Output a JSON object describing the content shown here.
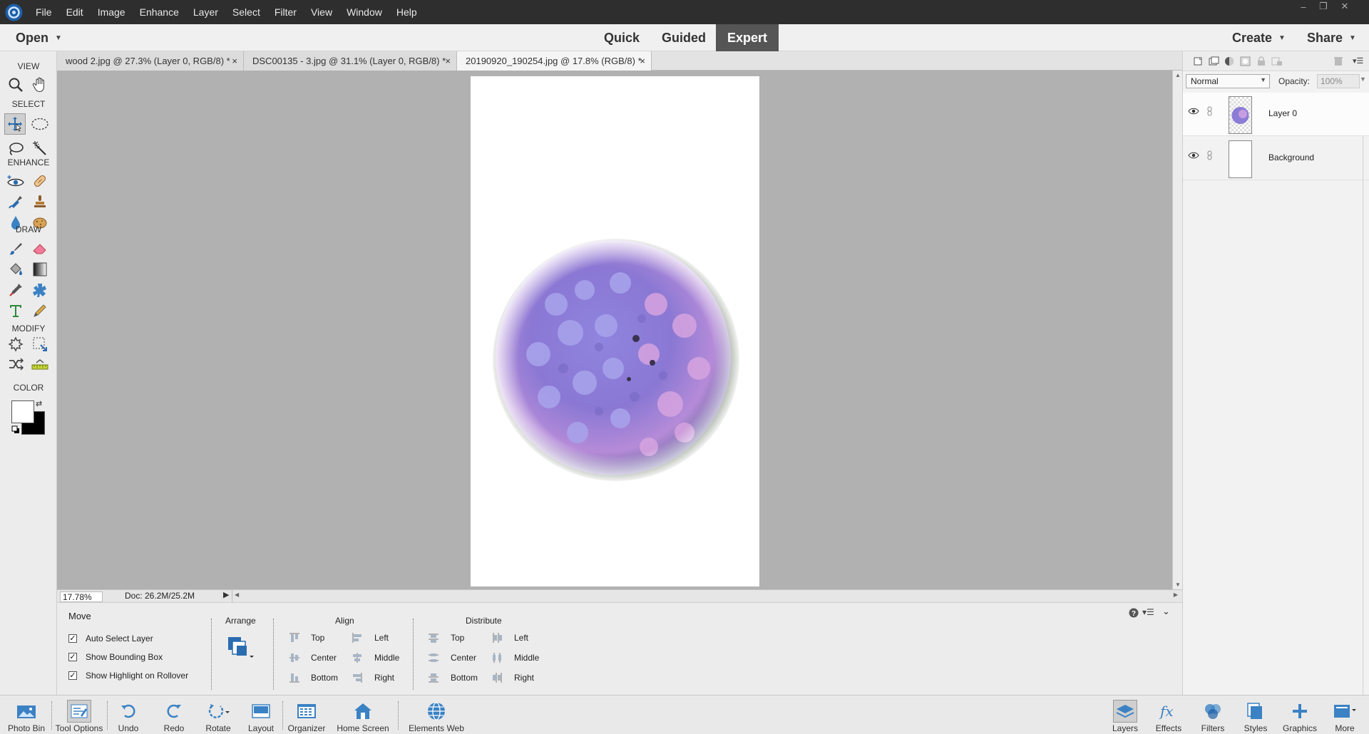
{
  "menu": [
    "File",
    "Edit",
    "Image",
    "Enhance",
    "Layer",
    "Select",
    "Filter",
    "View",
    "Window",
    "Help"
  ],
  "modebar": {
    "open": "Open",
    "modes": [
      "Quick",
      "Guided",
      "Expert"
    ],
    "active_mode": "Expert",
    "create": "Create",
    "share": "Share"
  },
  "tools": {
    "groups": [
      "VIEW",
      "SELECT",
      "ENHANCE",
      "DRAW",
      "MODIFY",
      "COLOR"
    ],
    "active_tool": "move-tool",
    "foreground_color": "#ffffff",
    "background_color": "#000000"
  },
  "tabs": [
    "wood 2.jpg @ 27.3% (Layer 0, RGB/8) *",
    "DSC00135 - 3.jpg @ 31.1% (Layer 0, RGB/8) *",
    "20190920_190254.jpg @ 17.8% (RGB/8) *"
  ],
  "active_tab": 2,
  "status": {
    "zoom": "17.78%",
    "doc": "Doc: 26.2M/25.2M"
  },
  "options": {
    "tool": "Move",
    "checkboxes": [
      "Auto Select Layer",
      "Show Bounding Box",
      "Show Highlight on Rollover"
    ],
    "checkbox_states": [
      true,
      true,
      true
    ],
    "arrange": "Arrange",
    "align": "Align",
    "align_items": [
      "Top",
      "Center",
      "Bottom",
      "Left",
      "Middle",
      "Right"
    ],
    "distribute": "Distribute",
    "distribute_items": [
      "Top",
      "Center",
      "Bottom",
      "Left",
      "Middle",
      "Right"
    ]
  },
  "layers": {
    "blend_mode": "Normal",
    "opacity_label": "Opacity:",
    "opacity": "100%",
    "items": [
      "Layer 0",
      "Background"
    ],
    "selected": "Layer 0"
  },
  "bottombar": [
    "Photo Bin",
    "Tool Options",
    "Undo",
    "Redo",
    "Rotate",
    "Layout",
    "Organizer",
    "Home Screen",
    "Elements Web",
    "Layers",
    "Effects",
    "Filters",
    "Styles",
    "Graphics",
    "More"
  ],
  "colors": {
    "accent": "#3b82c4",
    "menubar_bg": "#2e2e2e",
    "canvas_bg": "#b1b1b1",
    "active_mode_bg": "#555555"
  }
}
